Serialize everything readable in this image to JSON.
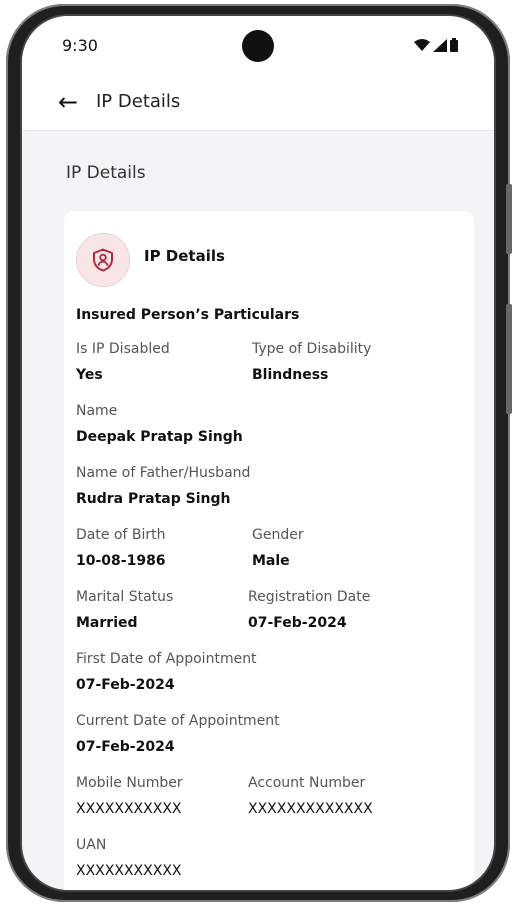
{
  "status_bar": {
    "time": "9:30"
  },
  "app_bar": {
    "title": "IP Details"
  },
  "page": {
    "section_title": "IP Details"
  },
  "card": {
    "header_title": "IP Details",
    "group_title": "Insured Person’s Particulars",
    "fields": {
      "is_ip_disabled": {
        "label": "Is IP Disabled",
        "value": "Yes"
      },
      "type_of_disability": {
        "label": "Type of Disability",
        "value": "Blindness"
      },
      "name": {
        "label": "Name",
        "value": "Deepak Pratap Singh"
      },
      "father_husband": {
        "label": "Name of Father/Husband",
        "value": "Rudra Pratap Singh"
      },
      "dob": {
        "label": "Date of Birth",
        "value": "10-08-1986"
      },
      "gender": {
        "label": "Gender",
        "value": "Male"
      },
      "marital_status": {
        "label": "Marital Status",
        "value": "Married"
      },
      "registration_date": {
        "label": "Registration Date",
        "value": "07-Feb-2024"
      },
      "first_appointment": {
        "label": "First Date of Appointment",
        "value": "07-Feb-2024"
      },
      "current_appointment": {
        "label": "Current Date of Appointment",
        "value": "07-Feb-2024"
      },
      "mobile": {
        "label": "Mobile Number",
        "value": "XXXXXXXXXXX"
      },
      "account": {
        "label": "Account Number",
        "value": "XXXXXXXXXXXXX"
      },
      "uan": {
        "label": "UAN",
        "value": "XXXXXXXXXXX"
      }
    }
  },
  "icons": {
    "back": "arrow-left-icon",
    "badge": "shield-user-icon",
    "wifi": "wifi-icon",
    "signal": "signal-icon",
    "battery": "battery-icon"
  },
  "colors": {
    "badge_bg": "#f8e6e6",
    "badge_icon": "#b0283c"
  }
}
